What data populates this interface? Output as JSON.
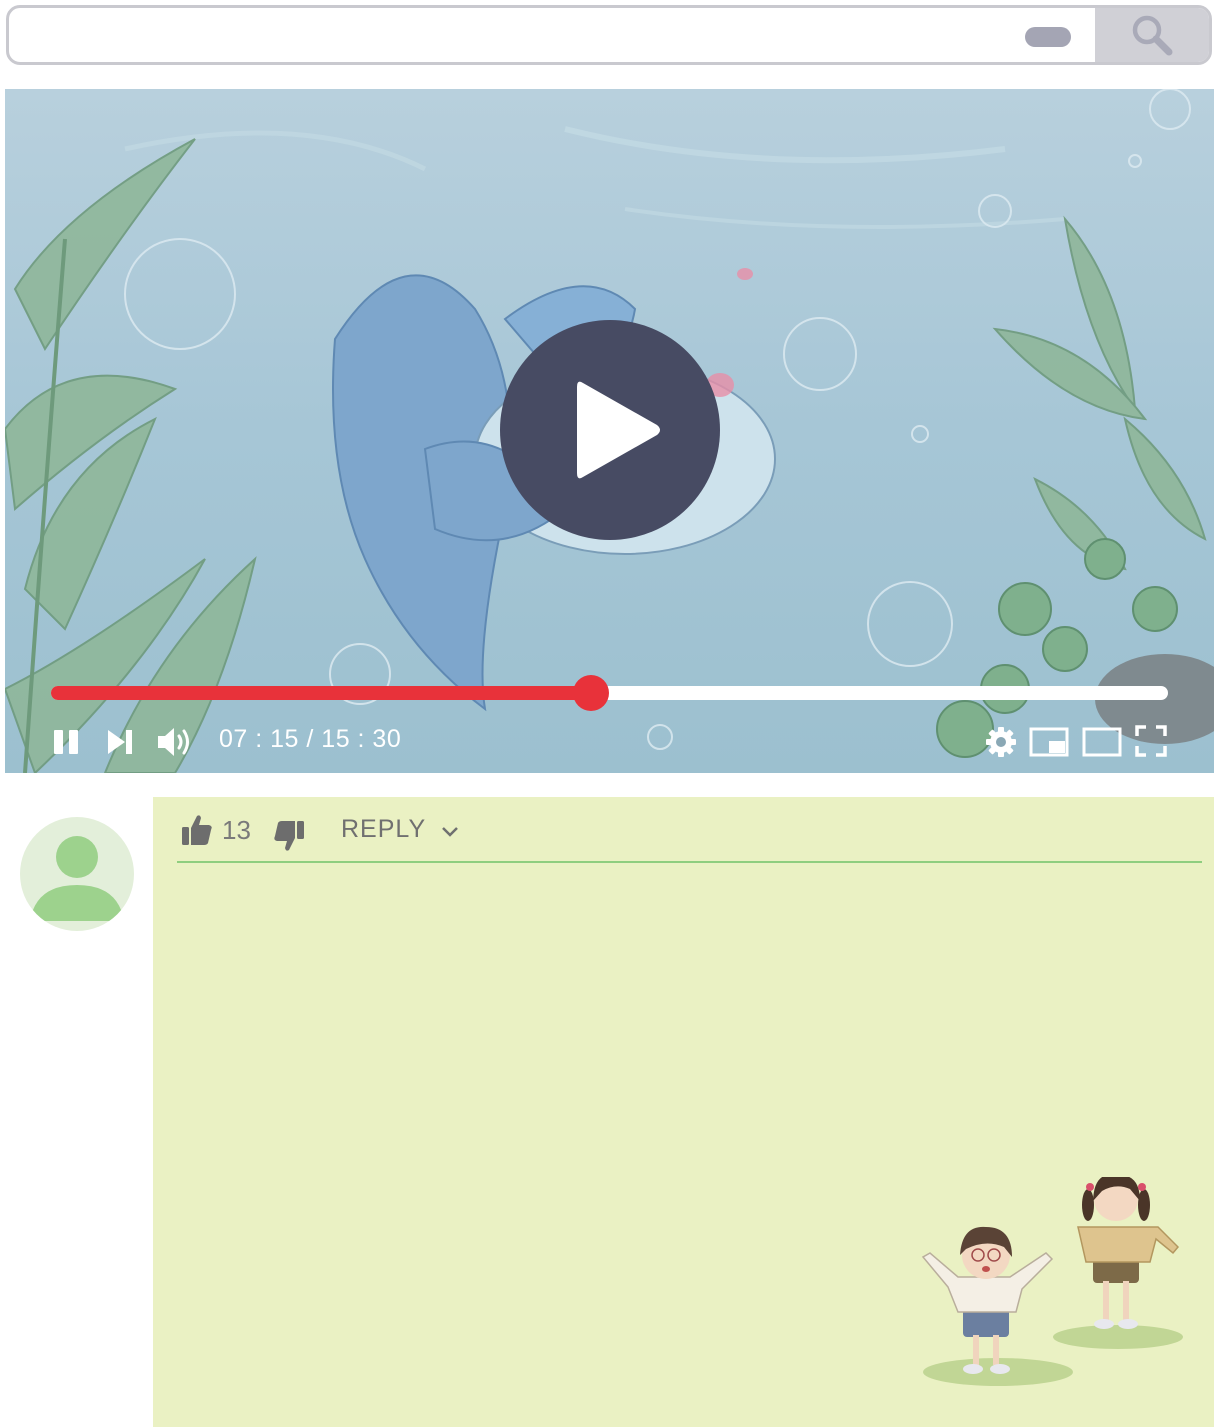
{
  "search": {
    "placeholder": "",
    "value": ""
  },
  "icons": {
    "search": "magnifier-icon",
    "play": "play-triangle-icon",
    "pause": "pause-icon",
    "next": "skip-next-icon",
    "volume": "volume-icon",
    "settings": "gear-icon",
    "miniplayer": "miniplayer-icon",
    "theater": "theater-mode-icon",
    "fullscreen": "fullscreen-icon",
    "like": "thumbs-up-icon",
    "dislike": "thumbs-down-icon",
    "reply_expand": "chevron-down-icon",
    "avatar": "user-avatar-icon"
  },
  "player": {
    "time_display": "07 : 15 / 15 : 30",
    "progress_fraction": 0.483
  },
  "comment": {
    "like_count": "13",
    "reply_label": "REPLY"
  },
  "colors": {
    "progress": "#e8323a",
    "play_button": "#474b63",
    "comment_bg": "#eaf1c3",
    "avatar_green": "#9dd28d",
    "divider": "#8fce7f"
  }
}
